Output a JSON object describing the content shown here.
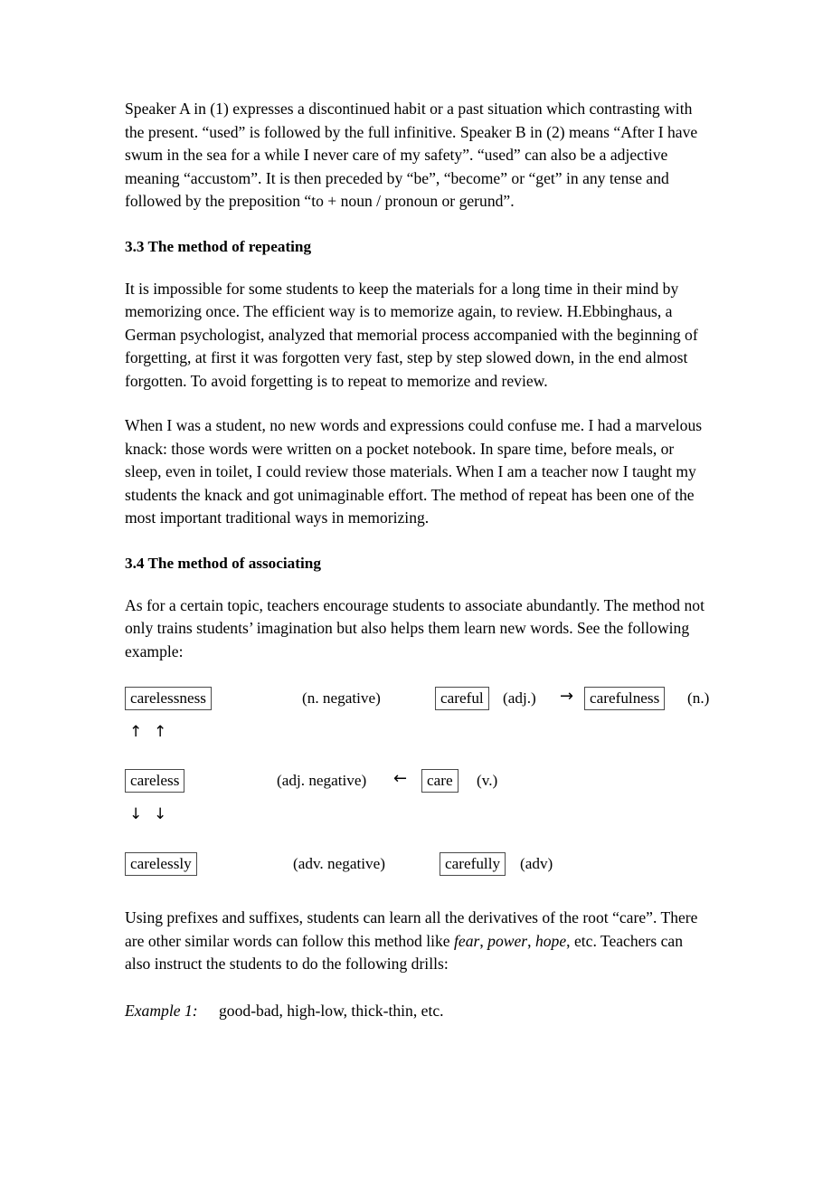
{
  "document": {
    "paragraphs": {
      "p1": "Speaker A in (1) expresses a discontinued habit or a past situation which contrasting with the present. “used” is followed by the full infinitive. Speaker B in (2) means “After I have swum in the sea for a while I never care of my safety”. “used” can also be a adjective meaning “accustom”. It is then preceded by “be”, “become” or “get” in any tense and followed by the preposition “to + noun / pronoun or gerund”.",
      "p2": "It is impossible for some students to keep the materials for a long time in their mind by memorizing once. The efficient way is to memorize again, to review. H.Ebbinghaus, a German psychologist, analyzed that memorial process accompanied with the beginning of forgetting, at first it was forgotten very fast, step by step slowed down, in the end almost forgotten. To avoid forgetting is to repeat to memorize and review.",
      "p3": "When I was a student, no new words and expressions could confuse me. I had a marvelous knack: those words were written on a pocket notebook. In spare time, before meals, or sleep, even in toilet, I could review those materials. When I am a teacher now I taught my students the knack and got unimaginable effort. The method of repeat has been one of the most important traditional ways in memorizing.",
      "p4": "As for a certain topic, teachers encourage students to associate abundantly. The method not only trains students’ imagination but also helps them learn new words. See the following example:"
    },
    "headings": {
      "h33": "3.3 The method of repeating",
      "h34": "3.4 The method of associating"
    },
    "diagram": {
      "row1": {
        "box_left": "carelessness",
        "label_left": "(n. negative)",
        "box_mid": "careful",
        "label_mid": "(adj.)",
        "arrow": "→",
        "box_right": "carefulness",
        "label_right": "(n.)"
      },
      "up_arrows": {
        "first": "↑",
        "second": "↑"
      },
      "row2": {
        "box_left": "careless",
        "label_left": "(adj. negative)",
        "arrow": "←",
        "box_mid": "care",
        "label_mid": "(v.)"
      },
      "down_arrows": {
        "first": "↓",
        "second": "↓"
      },
      "row3": {
        "box_left": "carelessly",
        "label_left": "(adv. negative)",
        "box_mid": "carefully",
        "label_mid": "(adv)"
      }
    },
    "closing": {
      "line1_a": "Using prefixes and suffixes, students can learn all the derivatives of the root “care”. There are other similar words can follow this method like ",
      "word1": "fear",
      "sep1": ", ",
      "word2": "power",
      "sep2": ", ",
      "word3": "hope",
      "line1_b": ", etc. Teachers can also instruct the students to do the following drills:"
    },
    "example": {
      "label": "Example 1:",
      "text": "good-bad, high-low, thick-thin, etc."
    }
  }
}
